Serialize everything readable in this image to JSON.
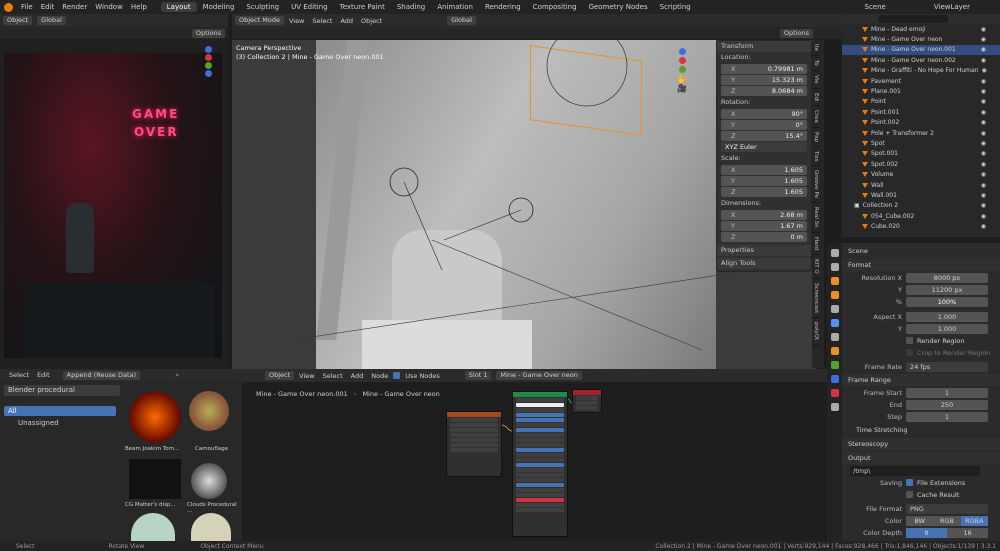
{
  "topbar": {
    "menus": [
      "File",
      "Edit",
      "Render",
      "Window",
      "Help"
    ],
    "workspaces": [
      "Layout",
      "Modeling",
      "Sculpting",
      "UV Editing",
      "Texture Paint",
      "Shading",
      "Animation",
      "Rendering",
      "Compositing",
      "Geometry Nodes",
      "Scripting"
    ],
    "active_workspace": "Layout",
    "scene": "Scene",
    "view_layer": "ViewLayer"
  },
  "left_viewport": {
    "mode": "Object",
    "transform": "Global",
    "options": "Options",
    "neon_text_1": "GAME",
    "neon_text_2": "OVER"
  },
  "main_viewport": {
    "mode": "Object Mode",
    "menus": [
      "View",
      "Select",
      "Add",
      "Object"
    ],
    "transform": "Global",
    "options": "Options",
    "info_line1": "Camera Perspective",
    "info_line2": "(3) Collection 2 | Mine - Game Over neon.001"
  },
  "npanel": {
    "transform_title": "Transform",
    "location_label": "Location:",
    "location": [
      {
        "k": "X",
        "v": "0.79981 m"
      },
      {
        "k": "Y",
        "v": "15.323 m"
      },
      {
        "k": "Z",
        "v": "8.0684 m"
      }
    ],
    "rotation_label": "Rotation:",
    "rotation": [
      {
        "k": "X",
        "v": "90°"
      },
      {
        "k": "Y",
        "v": "0°"
      },
      {
        "k": "Z",
        "v": "15.4°"
      }
    ],
    "rotation_mode": "XYZ Euler",
    "scale_label": "Scale:",
    "scale": [
      {
        "k": "X",
        "v": "1.605"
      },
      {
        "k": "Y",
        "v": "1.605"
      },
      {
        "k": "Z",
        "v": "1.605"
      }
    ],
    "dimensions_label": "Dimensions:",
    "dimensions": [
      {
        "k": "X",
        "v": "2.68 m"
      },
      {
        "k": "Y",
        "v": "1.67 m"
      },
      {
        "k": "Z",
        "v": "0 m"
      }
    ],
    "properties": "Properties",
    "align_tools": "Align Tools"
  },
  "vtabs": [
    "Ite",
    "To",
    "Vie",
    "Edi",
    "Crea",
    "Pap",
    "Tiss",
    "Groove Pe",
    "Real Sn",
    "Hard",
    "KIT O",
    "Screencast",
    "polyQt"
  ],
  "outliner": {
    "items": [
      {
        "name": "Mine - Dead emoji",
        "sel": false
      },
      {
        "name": "Mine - Game Over neon",
        "sel": false
      },
      {
        "name": "Mine - Game Over neon.001",
        "sel": true
      },
      {
        "name": "Mine - Game Over neon.002",
        "sel": false
      },
      {
        "name": "Mine - Graffiti - No Hope For Human",
        "sel": false
      },
      {
        "name": "Pavement",
        "sel": false
      },
      {
        "name": "Plane.001",
        "sel": false
      },
      {
        "name": "Point",
        "sel": false
      },
      {
        "name": "Point.001",
        "sel": false
      },
      {
        "name": "Point.002",
        "sel": false
      },
      {
        "name": "Pole + Transformer 2",
        "sel": false
      },
      {
        "name": "Spot",
        "sel": false
      },
      {
        "name": "Spot.001",
        "sel": false
      },
      {
        "name": "Spot.002",
        "sel": false
      },
      {
        "name": "Volume",
        "sel": false
      },
      {
        "name": "Wall",
        "sel": false
      },
      {
        "name": "Wall.001",
        "sel": false
      },
      {
        "name": "Collection 2",
        "sel": false
      },
      {
        "name": "054_Cube.002",
        "sel": false
      },
      {
        "name": "Cube.020",
        "sel": false
      }
    ]
  },
  "props": {
    "scene": "Scene",
    "format": "Format",
    "res_x_label": "Resolution X",
    "res_x": "8000 px",
    "res_y_label": "Y",
    "res_y": "11200 px",
    "pct_label": "%",
    "pct": "100%",
    "aspect_x_label": "Aspect X",
    "aspect_x": "1.000",
    "aspect_y_label": "Y",
    "aspect_y": "1.000",
    "render_region": "Render Region",
    "crop_region": "Crop to Render Region",
    "frame_rate_label": "Frame Rate",
    "frame_rate": "24 fps",
    "frame_range": "Frame Range",
    "start_label": "Frame Start",
    "start": "1",
    "end_label": "End",
    "end": "250",
    "step_label": "Step",
    "step": "1",
    "time_stretching": "Time Stretching",
    "stereoscopy": "Stereoscopy",
    "output": "Output",
    "path": "/tmp\\",
    "saving_label": "Saving",
    "file_ext": "File Extensions",
    "cache_result": "Cache Result",
    "file_format_label": "File Format",
    "file_format": "PNG",
    "color_label": "Color",
    "color_opts": [
      "BW",
      "RGB",
      "RGBA"
    ],
    "depth_label": "Color Depth",
    "depth_opts": [
      "8",
      "16"
    ]
  },
  "asset": {
    "menus": [
      "Select",
      "Edit"
    ],
    "import_mode": "Append (Reuse Data)",
    "library": "Blender procedural",
    "catalogs": [
      "All",
      "Unassigned"
    ],
    "items": [
      "Beam Joakim Tom...",
      "Camouflage",
      "CG Matter's disp...",
      "Clouds Procedural ..."
    ]
  },
  "nodes": {
    "object": "Object",
    "menus": [
      "View",
      "Select",
      "Add",
      "Node"
    ],
    "use_nodes": "Use Nodes",
    "slot": "Slot 1",
    "material": "Mine - Game Over neon",
    "breadcrumb1": "Mine - Game Over neon.001",
    "breadcrumb2": "Mine - Game Over neon"
  },
  "status": {
    "select": "Select",
    "rotate": "Rotate View",
    "context": "Object Context Menu",
    "stats": "Collection 2 | Mine - Game Over neon.001 | Verts:929,144 | Faces:928,466 | Tris:1,846,146 | Objects:1/139 | 3.3.1"
  }
}
